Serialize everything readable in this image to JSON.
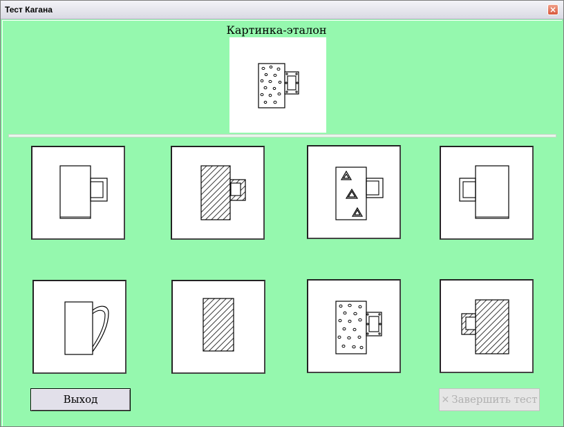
{
  "window": {
    "title": "Тест Кагана",
    "close_glyph": "×"
  },
  "reference": {
    "title": "Картинка-эталон",
    "image": "mug-dotted-body-dotted-handle"
  },
  "options": [
    {
      "id": 1,
      "image": "mug-plain-square-handle-right"
    },
    {
      "id": 2,
      "image": "mug-hatched-body-hatched-handle"
    },
    {
      "id": 3,
      "image": "mug-triangles-body-plain-handle"
    },
    {
      "id": 4,
      "image": "mug-plain-square-handle-left"
    },
    {
      "id": 5,
      "image": "mug-plain-curved-handle"
    },
    {
      "id": 6,
      "image": "hatched-rectangle-no-handle"
    },
    {
      "id": 7,
      "image": "mug-dotted-body-dotted-handle"
    },
    {
      "id": 8,
      "image": "mug-hatched-body-hatched-handle-left"
    }
  ],
  "buttons": {
    "exit_label": "Выход",
    "finish_label": "Завершить тест",
    "finish_icon": "cross-icon",
    "finish_enabled": false
  },
  "colors": {
    "background": "#95f8ae",
    "card": "#ffffff"
  }
}
